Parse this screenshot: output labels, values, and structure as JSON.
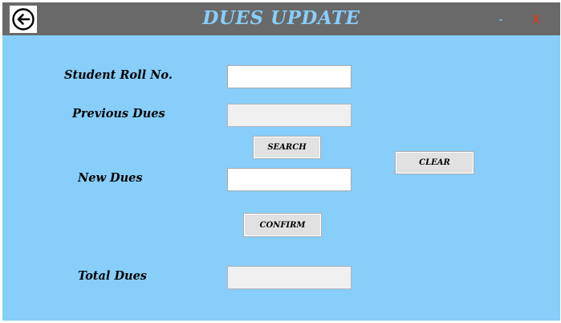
{
  "window": {
    "title": "DUES UPDATE",
    "minimize_label": "-",
    "close_label": "X"
  },
  "form": {
    "roll_label": "Student Roll No.",
    "roll_value": "",
    "previous_label": "Previous Dues",
    "previous_value": "",
    "new_label": "New Dues",
    "new_value": "",
    "total_label": "Total Dues",
    "total_value": ""
  },
  "buttons": {
    "search": "SEARCH",
    "clear": "CLEAR",
    "confirm": "CONFIRM"
  },
  "icons": {
    "back": "arrow-left-circle-icon"
  },
  "colors": {
    "titlebar_bg": "#696969",
    "title_text": "#87cefa",
    "window_bg": "#87cefa",
    "close_text": "#ff2a00"
  }
}
